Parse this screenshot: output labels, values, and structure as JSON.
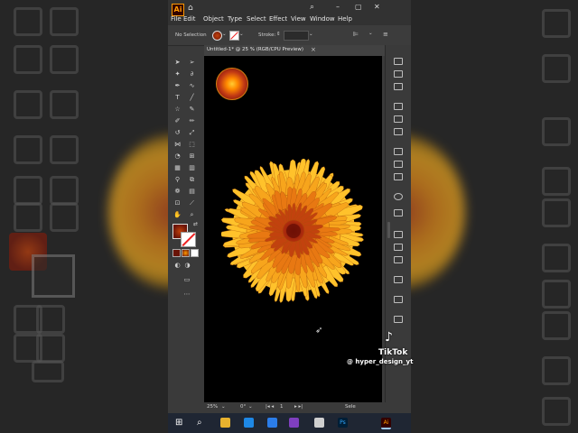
{
  "menubar": {
    "app_logo": "Ai",
    "items": [
      "File",
      "Edit",
      "Object",
      "Type",
      "Select",
      "Effect",
      "View",
      "Window",
      "Help"
    ]
  },
  "control_bar": {
    "selection": "No Selection",
    "stroke_label": "Stroke:"
  },
  "document_tab": {
    "title": "Untitled-1* @ 25 % (RGB/CPU Preview)",
    "close": "×"
  },
  "status_bar": {
    "zoom": "25%",
    "rotation": "0°",
    "artboard": "1",
    "tool": "Sele"
  },
  "watermark": {
    "brand": "TikTok",
    "handle": "@ hyper_design_yt"
  },
  "colors": {
    "canvas": "#000000",
    "flower_center": "#8a1c0c",
    "flower_mid": "#f08a10",
    "flower_outer": "#ffc22b",
    "accent": "#ff9a00"
  }
}
